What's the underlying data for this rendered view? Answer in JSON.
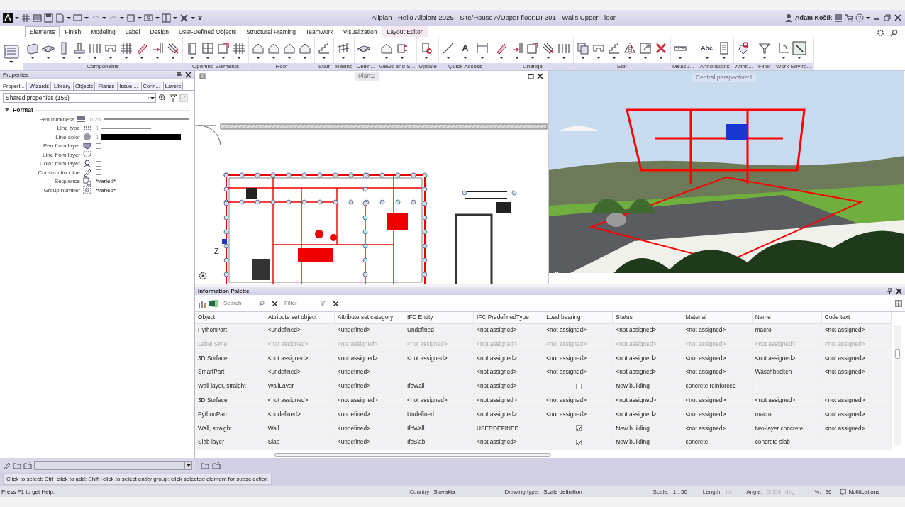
{
  "title_bar": {
    "app_title": "Allplan - Hello Allplan! 2025 - Site/House A/Upper floor:DF301 - Walls Upper Floor",
    "user": "Adam Košík"
  },
  "ribbon": {
    "tabs": [
      {
        "label": "Elements",
        "selected": true,
        "contextual": false
      },
      {
        "label": "Finish",
        "selected": false,
        "contextual": false
      },
      {
        "label": "Modeling",
        "selected": false,
        "contextual": false
      },
      {
        "label": "Label",
        "selected": false,
        "contextual": false
      },
      {
        "label": "Design",
        "selected": false,
        "contextual": false
      },
      {
        "label": "User-Defined Objects",
        "selected": false,
        "contextual": false
      },
      {
        "label": "Structural Framing",
        "selected": false,
        "contextual": false
      },
      {
        "label": "Teamwork",
        "selected": false,
        "contextual": false
      },
      {
        "label": "Visualization",
        "selected": false,
        "contextual": false
      },
      {
        "label": "Layout Editor",
        "selected": false,
        "contextual": true
      }
    ],
    "groups": [
      {
        "label": "Components",
        "buttons": [
          {
            "kind": "wall"
          },
          {
            "kind": "slab"
          },
          {
            "kind": "column"
          },
          {
            "kind": "footing"
          },
          {
            "kind": "frame"
          },
          {
            "kind": "bracket"
          },
          {
            "kind": "grid"
          },
          {
            "kind": "pencil"
          },
          {
            "kind": "joint"
          },
          {
            "kind": "hatch"
          }
        ]
      },
      {
        "label": "Opening Elements",
        "buttons": [
          {
            "kind": "door"
          },
          {
            "kind": "window"
          },
          {
            "kind": "opening"
          },
          {
            "kind": "grid"
          }
        ]
      },
      {
        "label": "Roof",
        "buttons": [
          {
            "kind": "house"
          },
          {
            "kind": "house"
          },
          {
            "kind": "house"
          },
          {
            "kind": "house"
          }
        ]
      },
      {
        "label": "Stair",
        "buttons": [
          {
            "kind": "stair"
          }
        ]
      },
      {
        "label": "Railing",
        "buttons": [
          {
            "kind": "railing"
          }
        ]
      },
      {
        "label": "Ceilin...",
        "buttons": [
          {
            "kind": "slab"
          }
        ]
      },
      {
        "label": "Views and S...",
        "buttons": [
          {
            "kind": "house"
          },
          {
            "kind": "section"
          }
        ]
      },
      {
        "label": "Update",
        "buttons": [
          {
            "kind": "update"
          }
        ]
      },
      {
        "label": "Quick Access",
        "buttons": [
          {
            "kind": "line"
          },
          {
            "kind": "glyph",
            "text": "A"
          },
          {
            "kind": "dimension"
          }
        ]
      },
      {
        "label": "Change",
        "buttons": [
          {
            "kind": "pencil"
          },
          {
            "kind": "joint"
          },
          {
            "kind": "opening"
          },
          {
            "kind": "hatch"
          },
          {
            "kind": "frame"
          }
        ]
      },
      {
        "label": "Edit",
        "buttons": [
          {
            "kind": "copy"
          },
          {
            "kind": "bracket"
          },
          {
            "kind": "stair"
          },
          {
            "kind": "mirror"
          },
          {
            "kind": "scale"
          },
          {
            "kind": "cross"
          }
        ]
      },
      {
        "label": "Measu...",
        "buttons": [
          {
            "kind": "ruler"
          }
        ]
      },
      {
        "label": "Annotations",
        "buttons": [
          {
            "kind": "glyph",
            "text": "Abc"
          },
          {
            "kind": "document"
          }
        ]
      },
      {
        "label": "Attrib...",
        "buttons": [
          {
            "kind": "tag"
          }
        ]
      },
      {
        "label": "Filter",
        "buttons": [
          {
            "kind": "funnel"
          }
        ]
      },
      {
        "label": "Work Enviro...",
        "buttons": [
          {
            "kind": "axes"
          },
          {
            "kind": "pointer"
          }
        ]
      }
    ]
  },
  "properties": {
    "title": "Properties",
    "tabs": [
      {
        "label": "Propert...",
        "selected": true
      },
      {
        "label": "Wizards",
        "selected": false
      },
      {
        "label": "Library",
        "selected": false
      },
      {
        "label": "Objects",
        "selected": false
      },
      {
        "label": "Planes",
        "selected": false
      },
      {
        "label": "Issue ...",
        "selected": false
      },
      {
        "label": "Conn...",
        "selected": false
      },
      {
        "label": "Layers",
        "selected": false
      }
    ],
    "selector": "Shared properties (156)",
    "section": {
      "label": "Format",
      "expanded": true
    },
    "rows": [
      {
        "label": "Pen thickness",
        "kind": "pen",
        "value": "0.25"
      },
      {
        "label": "Line type",
        "kind": "linetype",
        "value": "1"
      },
      {
        "label": "Line color",
        "kind": "color",
        "value": "1"
      },
      {
        "label": "Pen from layer",
        "kind": "checkbox",
        "checked": false
      },
      {
        "label": "Line from layer",
        "kind": "checkbox",
        "checked": false
      },
      {
        "label": "Color from layer",
        "kind": "checkbox",
        "checked": false
      },
      {
        "label": "Construction line",
        "kind": "checkbox",
        "checked": false
      },
      {
        "label": "Sequence",
        "kind": "text",
        "value": "*varied*"
      },
      {
        "label": "Group number",
        "kind": "text",
        "value": "*varied*"
      }
    ]
  },
  "plan_view": {
    "tab": "Plan:2",
    "axis_label": "Z"
  },
  "perspective_view": {
    "tab": "Central perspective:1"
  },
  "info_palette": {
    "title": "Information Palette",
    "search": {
      "placeholder": "Search"
    },
    "filter": {
      "placeholder": "Filter"
    },
    "columns": [
      "Object",
      "Attribute set object",
      "Attribute set category",
      "IFC Entity",
      "IFC PredefinedType",
      "Load bearing",
      "Status",
      "Material",
      "Name",
      "Code text"
    ],
    "rows": [
      {
        "disabled": false,
        "cells": [
          "PythonPart",
          "<undefined>",
          "<undefined>",
          "Undefined",
          "<not assigned>",
          "<not assigned>",
          "<not assigned>",
          "<not assigned>",
          "macro",
          "<not assigned>"
        ]
      },
      {
        "disabled": true,
        "cells": [
          "Label Style",
          "<not assigned>",
          "<not assigned>",
          "<not assigned>",
          "<not assigned>",
          "<not assigned>",
          "<not assigned>",
          "<not assigned>",
          "<not assigned>",
          "<not assigned>"
        ]
      },
      {
        "disabled": false,
        "cells": [
          "3D Surface",
          "<not assigned>",
          "<not assigned>",
          "<not assigned>",
          "<not assigned>",
          "<not assigned>",
          "<not assigned>",
          "<not assigned>",
          "<not assigned>",
          "<not assigned>"
        ]
      },
      {
        "disabled": false,
        "cells": [
          "SmartPart",
          "<undefined>",
          "<undefined>",
          null,
          "<not assigned>",
          "<not assigned>",
          "<not assigned>",
          "<not assigned>",
          "Waschbecken",
          "<not assigned>"
        ]
      },
      {
        "disabled": false,
        "cells": [
          "Wall layer, straight",
          "WallLayer",
          "<undefined>",
          "IfcWall",
          "<not assigned>",
          {
            "kind": "checkbox",
            "checked": false
          },
          "New building",
          "concrete reinforced",
          null,
          null
        ]
      },
      {
        "disabled": false,
        "cells": [
          "3D Surface",
          "<not assigned>",
          "<not assigned>",
          "<not assigned>",
          "<not assigned>",
          "<not assigned>",
          "<not assigned>",
          "<not assigned>",
          "<not assigned>",
          "<not assigned>"
        ]
      },
      {
        "disabled": false,
        "cells": [
          "PythonPart",
          "<undefined>",
          "<undefined>",
          "Undefined",
          "<not assigned>",
          "<not assigned>",
          "<not assigned>",
          "<not assigned>",
          "macro",
          "<not assigned>"
        ]
      },
      {
        "disabled": false,
        "cells": [
          "Wall, straight",
          "Wall",
          "<undefined>",
          "IfcWall",
          "USERDEFINED",
          {
            "kind": "checkbox",
            "checked": true
          },
          "New building",
          "<not assigned>",
          "two-layer concrete",
          "<not assigned>"
        ]
      },
      {
        "disabled": false,
        "cells": [
          "Slab layer",
          "Slab",
          "<undefined>",
          "IfcSlab",
          "<not assigned>",
          {
            "kind": "checkbox",
            "checked": true
          },
          "New building",
          "concrete",
          "concrete slab",
          null
        ]
      }
    ]
  },
  "hint": "Click to select; Ctrl+click to add; Shift+click to select entity group; click selected element for subselection",
  "status_bar": {
    "help": "Press F1 to get Help.",
    "fields": [
      {
        "label": "Country",
        "value": "Slovakia",
        "disabled": false
      },
      {
        "label": "Drawing type:",
        "value": "Scale definition",
        "disabled": false
      },
      {
        "label": "Scale:",
        "value": "1 : 50",
        "disabled": false
      },
      {
        "label": "Length:",
        "unit": "m",
        "disabled": true
      },
      {
        "label": "Angle:",
        "value": "0.000",
        "unit": "deg",
        "disabled": true
      },
      {
        "label": "%:",
        "value": "36",
        "disabled": false
      }
    ],
    "notifications": "Notifications"
  }
}
